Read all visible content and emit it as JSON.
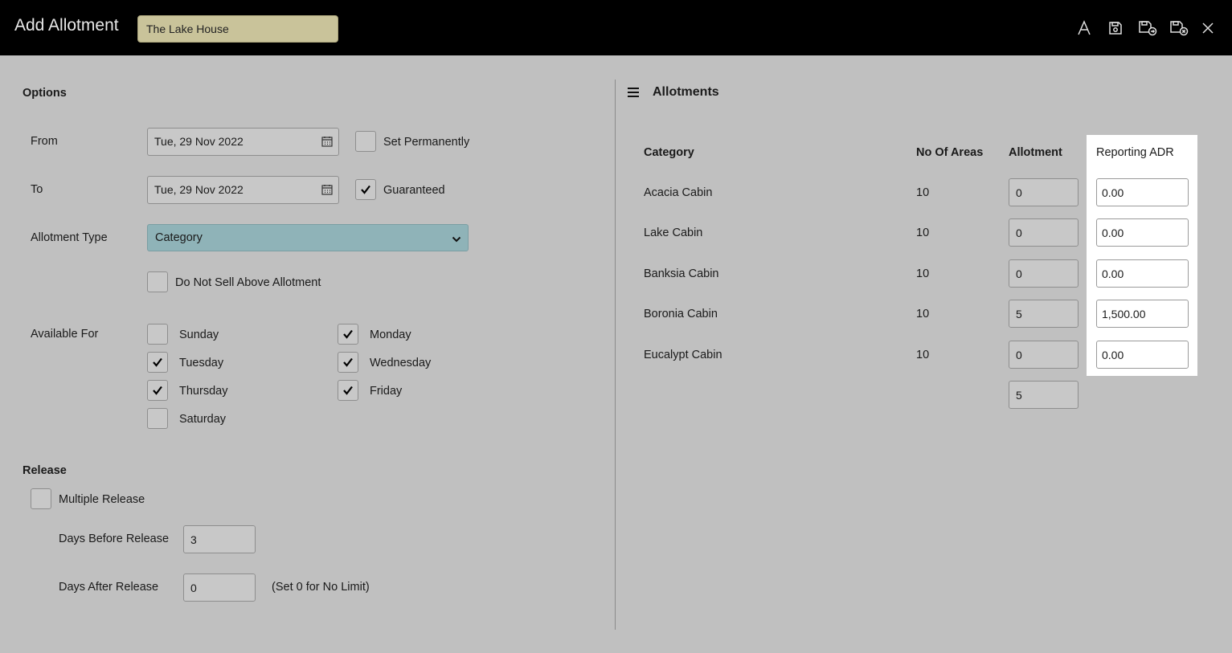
{
  "header": {
    "title": "Add Allotment",
    "property": "The Lake House",
    "icons": [
      "font-icon",
      "save-icon",
      "save-and-new-icon",
      "save-and-close-icon",
      "close-icon"
    ]
  },
  "options": {
    "section_title": "Options",
    "from_label": "From",
    "from_value": "Tue, 29 Nov 2022",
    "set_permanently_label": "Set Permanently",
    "set_permanently": false,
    "to_label": "To",
    "to_value": "Tue, 29 Nov 2022",
    "guaranteed_label": "Guaranteed",
    "guaranteed": true,
    "allotment_type_label": "Allotment Type",
    "allotment_type_value": "Category",
    "do_not_sell_label": "Do Not Sell Above Allotment",
    "do_not_sell": false,
    "available_for_label": "Available For",
    "days": {
      "sunday": {
        "label": "Sunday",
        "checked": false
      },
      "monday": {
        "label": "Monday",
        "checked": true
      },
      "tuesday": {
        "label": "Tuesday",
        "checked": true
      },
      "wednesday": {
        "label": "Wednesday",
        "checked": true
      },
      "thursday": {
        "label": "Thursday",
        "checked": true
      },
      "friday": {
        "label": "Friday",
        "checked": true
      },
      "saturday": {
        "label": "Saturday",
        "checked": false
      }
    }
  },
  "release": {
    "section_title": "Release",
    "multiple_release_label": "Multiple Release",
    "multiple_release": false,
    "days_before_label": "Days Before Release",
    "days_before_value": "3",
    "days_after_label": "Days After Release",
    "days_after_value": "0",
    "days_after_hint": "(Set 0 for No Limit)"
  },
  "allotments": {
    "title": "Allotments",
    "columns": {
      "category": "Category",
      "no_of_areas": "No Of Areas",
      "allotment": "Allotment",
      "reporting_adr": "Reporting ADR"
    },
    "rows": [
      {
        "category": "Acacia Cabin",
        "areas": "10",
        "allotment": "0",
        "adr": "0.00"
      },
      {
        "category": "Lake Cabin",
        "areas": "10",
        "allotment": "0",
        "adr": "0.00"
      },
      {
        "category": "Banksia Cabin",
        "areas": "10",
        "allotment": "0",
        "adr": "0.00"
      },
      {
        "category": "Boronia Cabin",
        "areas": "10",
        "allotment": "5",
        "adr": "1,500.00"
      },
      {
        "category": "Eucalypt Cabin",
        "areas": "10",
        "allotment": "0",
        "adr": "0.00"
      }
    ],
    "total_allotment": "5"
  }
}
